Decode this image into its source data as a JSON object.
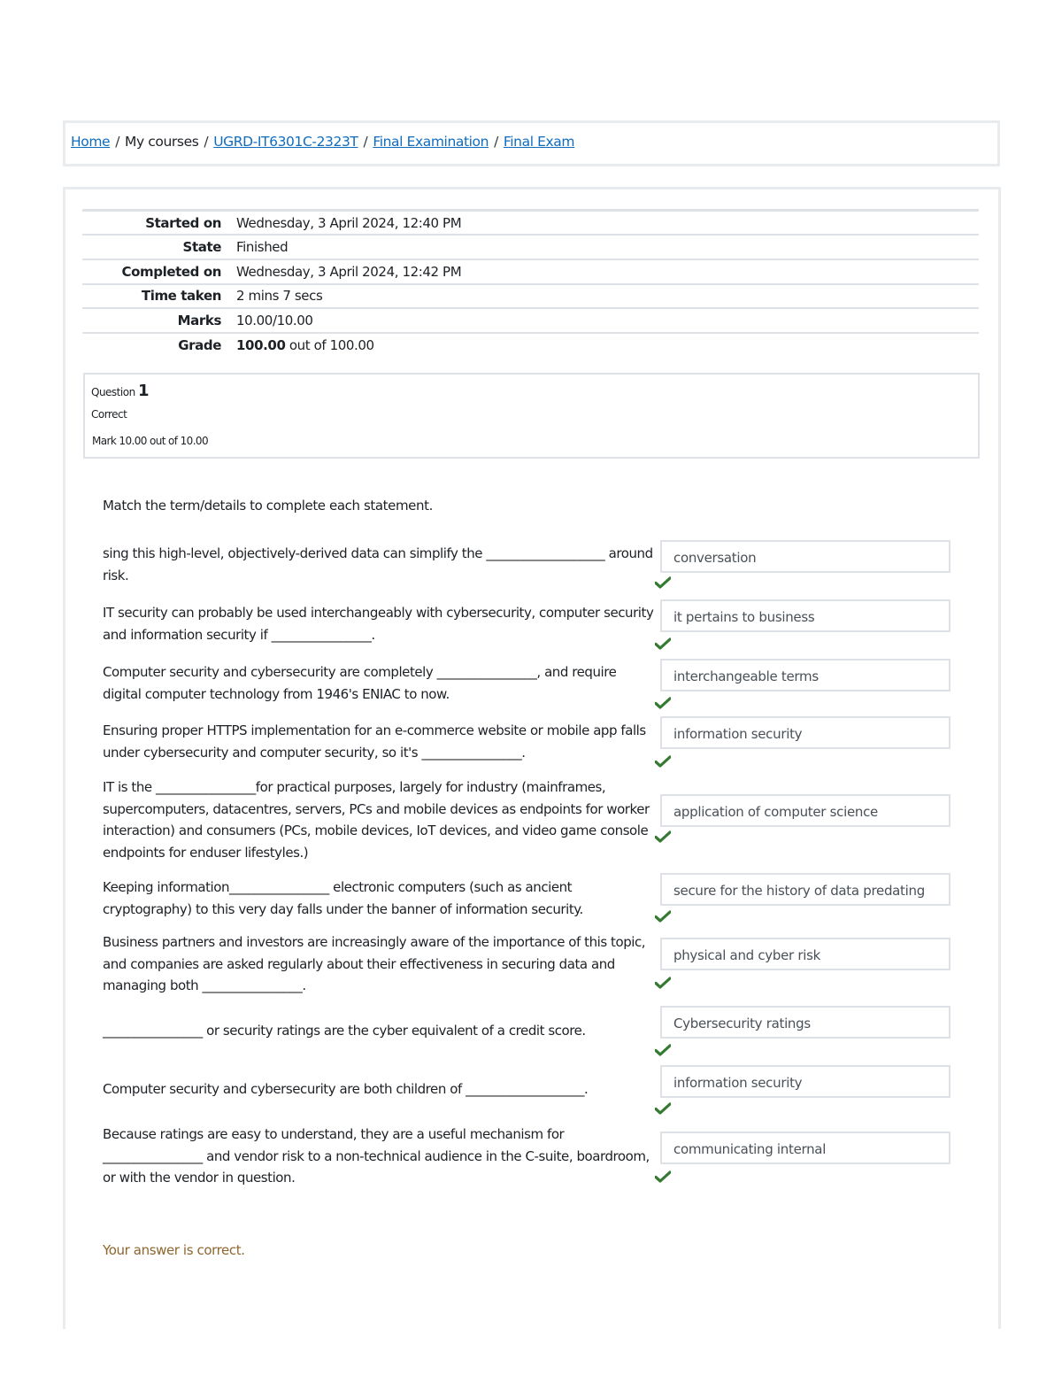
{
  "breadcrumb": [
    {
      "label": "Home",
      "link": true
    },
    {
      "label": "My courses",
      "link": false
    },
    {
      "label": "UGRD-IT6301C-2323T",
      "link": true
    },
    {
      "label": "Final Examination",
      "link": true
    },
    {
      "label": "Final Exam",
      "link": true
    }
  ],
  "summary": {
    "rows": [
      {
        "label": "Started on",
        "value": "Wednesday, 3 April 2024, 12:40 PM"
      },
      {
        "label": "State",
        "value": "Finished"
      },
      {
        "label": "Completed on",
        "value": "Wednesday, 3 April 2024, 12:42 PM"
      },
      {
        "label": "Time taken",
        "value": "2 mins 7 secs"
      },
      {
        "label": "Marks",
        "value": "10.00/10.00"
      }
    ],
    "grade": {
      "label": "Grade",
      "score": "100.00",
      "suffix": "out of 100.00"
    }
  },
  "question": {
    "prefix": "Question",
    "number": "1",
    "state": "Correct",
    "mark": "Mark 10.00 out of 10.00",
    "text": "Match the term/details to complete each statement.",
    "items": [
      {
        "statement": "sing this high-level, objectively-derived data can simplify the ___________________ around risk.",
        "answer": "conversation",
        "correct": true
      },
      {
        "statement": "IT security can probably be used interchangeably with cybersecurity, computer security and information security if ________________.",
        "answer": "it pertains to business",
        "correct": true
      },
      {
        "statement": "Computer security and cybersecurity are completely ________________, and require digital computer technology from 1946's ENIAC to now.",
        "answer": "interchangeable terms",
        "correct": true
      },
      {
        "statement": "Ensuring proper HTTPS implementation for an e-commerce website or mobile app falls under cybersecurity and computer security, so it's ________________.",
        "answer": "information security",
        "correct": true
      },
      {
        "statement": " IT is the ________________for practical purposes, largely for industry (mainframes, supercomputers, datacentres, servers, PCs and mobile devices as endpoints for worker interaction) and consumers (PCs, mobile devices, IoT devices, and video game console endpoints for enduser lifestyles.)",
        "answer": "application of computer science",
        "correct": true
      },
      {
        "statement": "Keeping information________________ electronic computers (such as ancient cryptography) to this very day falls under the banner of information security.",
        "answer": "secure for the history of data predating",
        "correct": true
      },
      {
        "statement": "Business partners and investors are increasingly aware of the importance of this topic, and companies are asked regularly about their effectiveness in securing data and managing both ________________.",
        "answer": "physical and cyber risk",
        "correct": true
      },
      {
        "statement": "________________ or security ratings are the cyber equivalent of a credit score.",
        "answer": "Cybersecurity ratings",
        "correct": true
      },
      {
        "statement": "Computer security and cybersecurity are both children of ___________________.",
        "answer": "information security",
        "correct": true
      },
      {
        "statement": " Because ratings are easy to understand, they are a useful mechanism for ________________ and vendor risk to a non-technical audience in the C-suite, boardroom, or with the vendor in question.",
        "answer": "communicating internal",
        "correct": true
      }
    ]
  },
  "feedback": "Your answer is correct.",
  "colors": {
    "link": "#0f6cbf",
    "check": "#357a32",
    "feedback": "#8e662e",
    "border": "#dee2e6"
  },
  "icons": {
    "correct": "check-icon"
  }
}
